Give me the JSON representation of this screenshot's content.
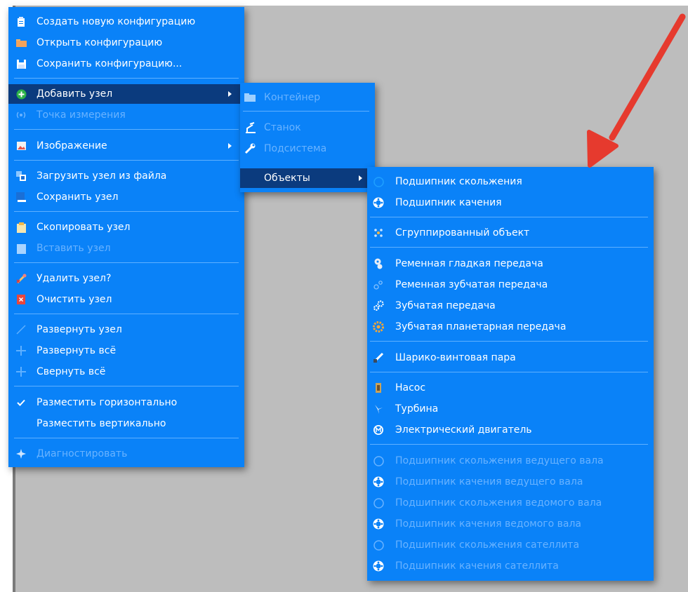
{
  "colors": {
    "menu_bg": "#0a82f8",
    "active_bg": "#0b3b7e",
    "disabled_text": "#6ab3ff",
    "annotation_arrow": "#e63a2e"
  },
  "main_menu": {
    "items": [
      {
        "label": "Создать новую конфигурацию",
        "icon": "clipboard-icon"
      },
      {
        "label": "Открыть конфигурацию",
        "icon": "folder-icon"
      },
      {
        "label": "Сохранить конфигурацию...",
        "icon": "floppy-icon"
      },
      {
        "label": "Добавить узел",
        "icon": "plus-circle-icon"
      },
      {
        "label": "Точка измерения",
        "icon": "signal-icon"
      },
      {
        "label": "Изображение",
        "icon": "image-icon"
      },
      {
        "label": "Загрузить узел из файла",
        "icon": "load-node-icon"
      },
      {
        "label": "Сохранить узел",
        "icon": "save-node-icon"
      },
      {
        "label": "Скопировать узел",
        "icon": "copy-icon"
      },
      {
        "label": "Вставить узел",
        "icon": "paste-icon"
      },
      {
        "label": "Удалить узел?",
        "icon": "delete-node-icon"
      },
      {
        "label": "Очистить узел",
        "icon": "clear-icon"
      },
      {
        "label": "Развернуть узел",
        "icon": "expand-node-icon"
      },
      {
        "label": "Развернуть всё",
        "icon": "expand-all-icon"
      },
      {
        "label": "Свернуть всё",
        "icon": "collapse-all-icon"
      },
      {
        "label": "Разместить горизонтально",
        "icon": "checkmark-icon"
      },
      {
        "label": "Разместить вертикально",
        "icon": ""
      },
      {
        "label": "Диагностировать",
        "icon": "diagnose-icon"
      }
    ]
  },
  "add_node_submenu": {
    "items": [
      {
        "label": "Контейнер",
        "icon": "folder-icon"
      },
      {
        "label": "Станок",
        "icon": "machine-icon"
      },
      {
        "label": "Подсистема",
        "icon": "wrench-icon"
      },
      {
        "label": "Объекты",
        "icon": ""
      }
    ]
  },
  "objects_submenu": {
    "items": [
      {
        "label": "Подшипник скольжения",
        "icon": "sliding-bearing-icon"
      },
      {
        "label": "Подшипник качения",
        "icon": "rolling-bearing-icon"
      },
      {
        "label": "Сгруппированный объект",
        "icon": "grouped-object-icon"
      },
      {
        "label": "Ременная гладкая передача",
        "icon": "flat-belt-icon"
      },
      {
        "label": "Ременная зубчатая  передача",
        "icon": "toothed-belt-icon"
      },
      {
        "label": "Зубчатая передача",
        "icon": "gears-icon"
      },
      {
        "label": "Зубчатая планетарная передача",
        "icon": "planetary-gear-icon"
      },
      {
        "label": "Шарико-винтовая пара",
        "icon": "ball-screw-icon"
      },
      {
        "label": "Насос",
        "icon": "pump-icon"
      },
      {
        "label": "Турбина",
        "icon": "turbine-icon"
      },
      {
        "label": "Электрический двигатель",
        "icon": "motor-icon"
      },
      {
        "label": "Подшипник скольжения ведущего вала",
        "icon": "sliding-bearing-icon"
      },
      {
        "label": "Подшипник качения ведущего вала",
        "icon": "rolling-bearing-icon"
      },
      {
        "label": "Подшипник скольжения ведомого вала",
        "icon": "sliding-bearing-icon"
      },
      {
        "label": "Подшипник качения ведомого вала",
        "icon": "rolling-bearing-icon"
      },
      {
        "label": "Подшипник скольжения  сателлита",
        "icon": "sliding-bearing-icon"
      },
      {
        "label": "Подшипник качения сателлита",
        "icon": "rolling-bearing-icon"
      }
    ]
  }
}
